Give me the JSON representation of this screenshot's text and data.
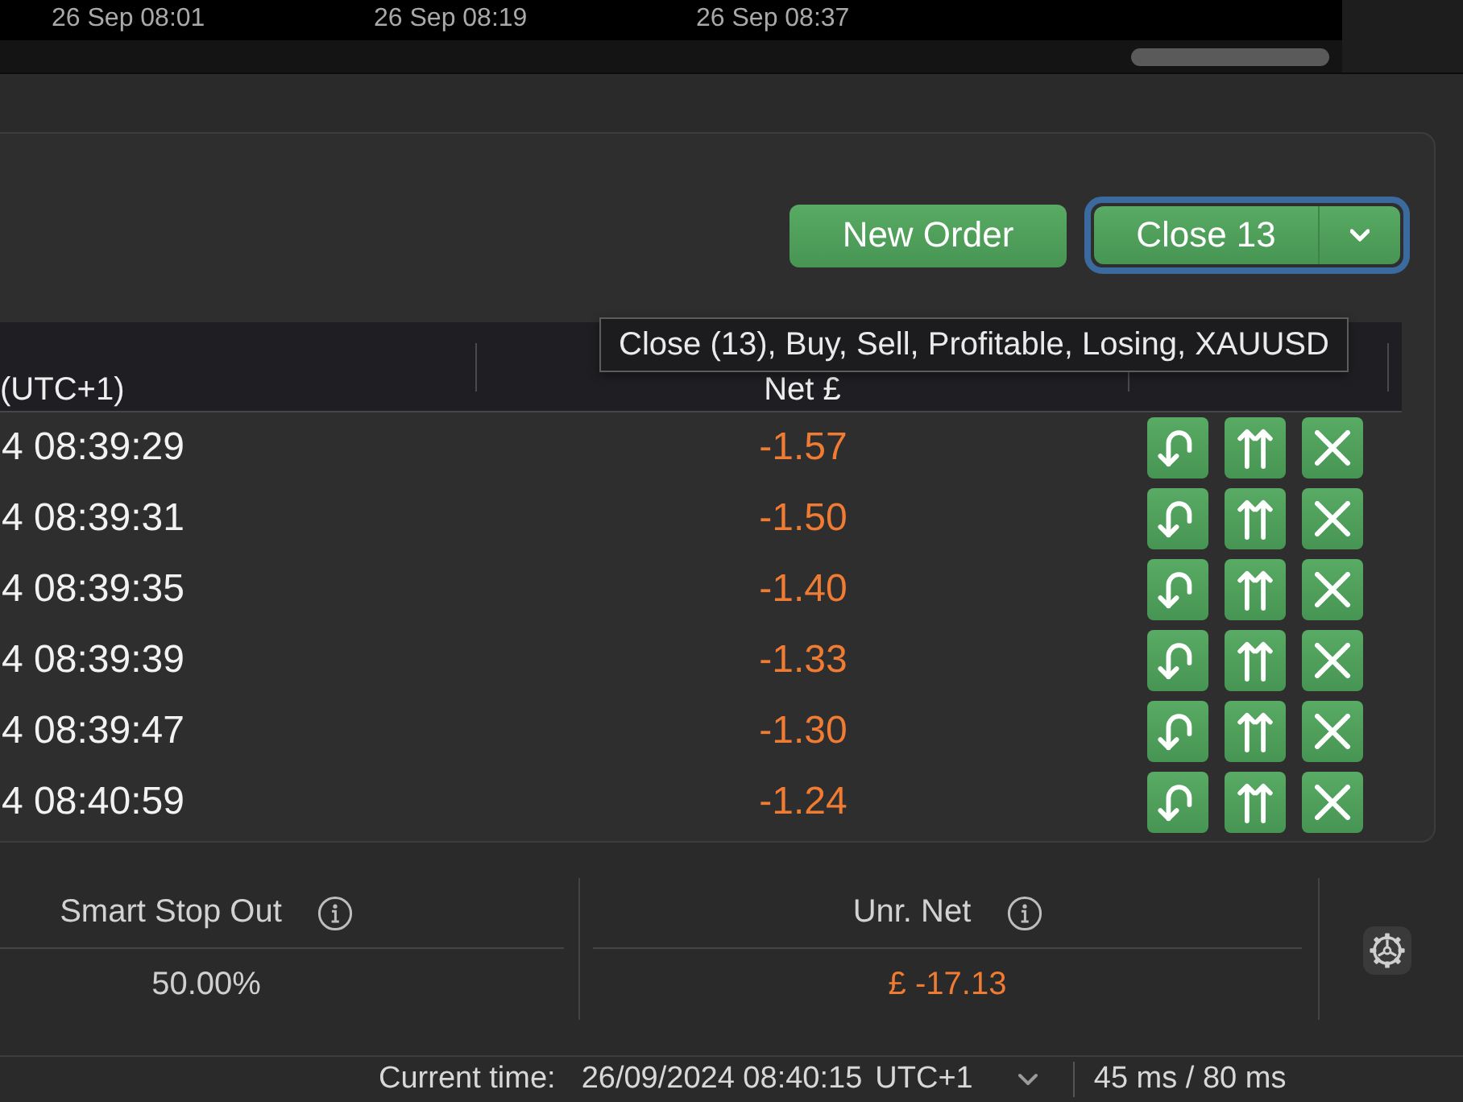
{
  "chart": {
    "time_labels": [
      "26 Sep 08:01",
      "26 Sep 08:19",
      "26 Sep 08:37"
    ]
  },
  "toolbar": {
    "new_order": {
      "label": "New Order"
    },
    "close_button": {
      "label": "Close 13",
      "focused": true
    }
  },
  "tooltip": {
    "text": "Close (13), Buy, Sell, Profitable, Losing, XAUUSD"
  },
  "table": {
    "columns": [
      "(UTC+1)",
      "Net £"
    ],
    "rows": [
      {
        "time": "4 08:39:29",
        "net": "-1.57",
        "loss": true
      },
      {
        "time": "4 08:39:31",
        "net": "-1.50",
        "loss": true
      },
      {
        "time": "4 08:39:35",
        "net": "-1.40",
        "loss": true
      },
      {
        "time": "4 08:39:39",
        "net": "-1.33",
        "loss": true
      },
      {
        "time": "4 08:39:47",
        "net": "-1.30",
        "loss": true
      },
      {
        "time": "4 08:40:59",
        "net": "-1.24",
        "loss": true
      }
    ]
  },
  "summary": [
    {
      "label": "Smart Stop Out",
      "value": "50.00%",
      "loss": false
    },
    {
      "label": "Unr. Net",
      "value": "£ -17.13",
      "loss": true
    }
  ],
  "status_bar": {
    "time_label": "Current time:",
    "time_value": "26/09/2024 08:40:15",
    "timezone": "UTC+1",
    "latency": "45 ms / 80 ms"
  }
}
